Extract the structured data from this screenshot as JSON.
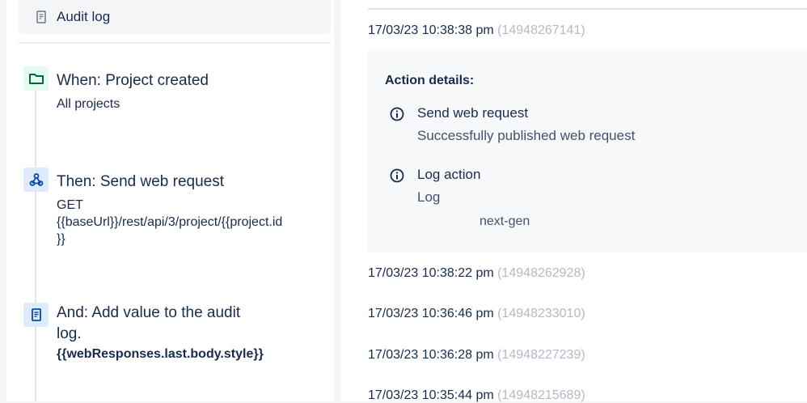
{
  "left": {
    "audit_log_label": "Audit log",
    "steps": [
      {
        "icon": "folder-icon",
        "title": "When: Project created",
        "sub": "All projects"
      },
      {
        "icon": "webhook-icon",
        "title": "Then: Send web request",
        "sub_lines": [
          "GET",
          "{{baseUrl}}/rest/api/3/project/{{project.id",
          "}}"
        ]
      },
      {
        "icon": "document-icon",
        "title_lines": [
          "And: Add value to the audit",
          "log."
        ],
        "sub": "{{webResponses.last.body.style}}"
      }
    ]
  },
  "right": {
    "entries": [
      {
        "time": "17/03/23 10:38:38 pm",
        "id": "(14948267141)"
      },
      {
        "time": "17/03/23 10:38:22 pm",
        "id": "(14948262928)"
      },
      {
        "time": "17/03/23 10:36:46 pm",
        "id": "(14948233010)"
      },
      {
        "time": "17/03/23 10:36:28 pm",
        "id": "(14948227239)"
      },
      {
        "time": "17/03/23 10:35:44 pm",
        "id": "(14948215689)"
      }
    ],
    "details": {
      "heading": "Action details:",
      "items": [
        {
          "title": "Send web request",
          "message": "Successfully published web request"
        },
        {
          "title": "Log action",
          "message": "Log",
          "extra": "next-gen"
        }
      ]
    }
  },
  "colors": {
    "green_bg": "#e3fcef",
    "green": "#006644",
    "blue_bg": "#deebff",
    "blue": "#0747a6"
  }
}
